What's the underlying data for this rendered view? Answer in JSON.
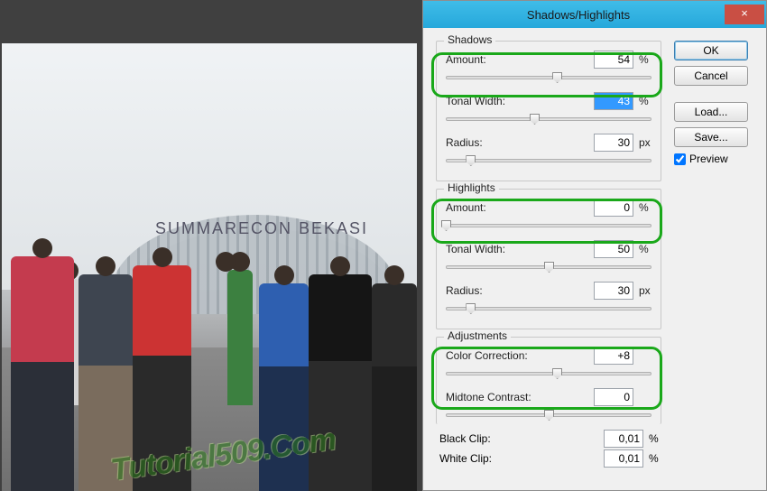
{
  "dialog": {
    "title": "Shadows/Highlights",
    "buttons": {
      "ok": "OK",
      "cancel": "Cancel",
      "load": "Load...",
      "save": "Save..."
    },
    "preview_label": "Preview",
    "preview_checked": true
  },
  "shadows": {
    "legend": "Shadows",
    "amount": {
      "label": "Amount:",
      "value": "54",
      "unit": "%",
      "pos": 54
    },
    "tonal": {
      "label": "Tonal Width:",
      "value": "43",
      "unit": "%",
      "pos": 43,
      "selected": true
    },
    "radius": {
      "label": "Radius:",
      "value": "30",
      "unit": "px",
      "pos": 12
    }
  },
  "highlights": {
    "legend": "Highlights",
    "amount": {
      "label": "Amount:",
      "value": "0",
      "unit": "%",
      "pos": 0
    },
    "tonal": {
      "label": "Tonal Width:",
      "value": "50",
      "unit": "%",
      "pos": 50
    },
    "radius": {
      "label": "Radius:",
      "value": "30",
      "unit": "px",
      "pos": 12
    }
  },
  "adjustments": {
    "legend": "Adjustments",
    "color": {
      "label": "Color Correction:",
      "value": "+8",
      "pos": 54
    },
    "midtone": {
      "label": "Midtone Contrast:",
      "value": "0",
      "pos": 50
    },
    "black": {
      "label": "Black Clip:",
      "value": "0,01",
      "unit": "%"
    },
    "white": {
      "label": "White Clip:",
      "value": "0,01",
      "unit": "%"
    }
  },
  "image": {
    "landmark_text": "SUMMARECON BEKASI",
    "watermark": "Tutorial509.Com"
  }
}
